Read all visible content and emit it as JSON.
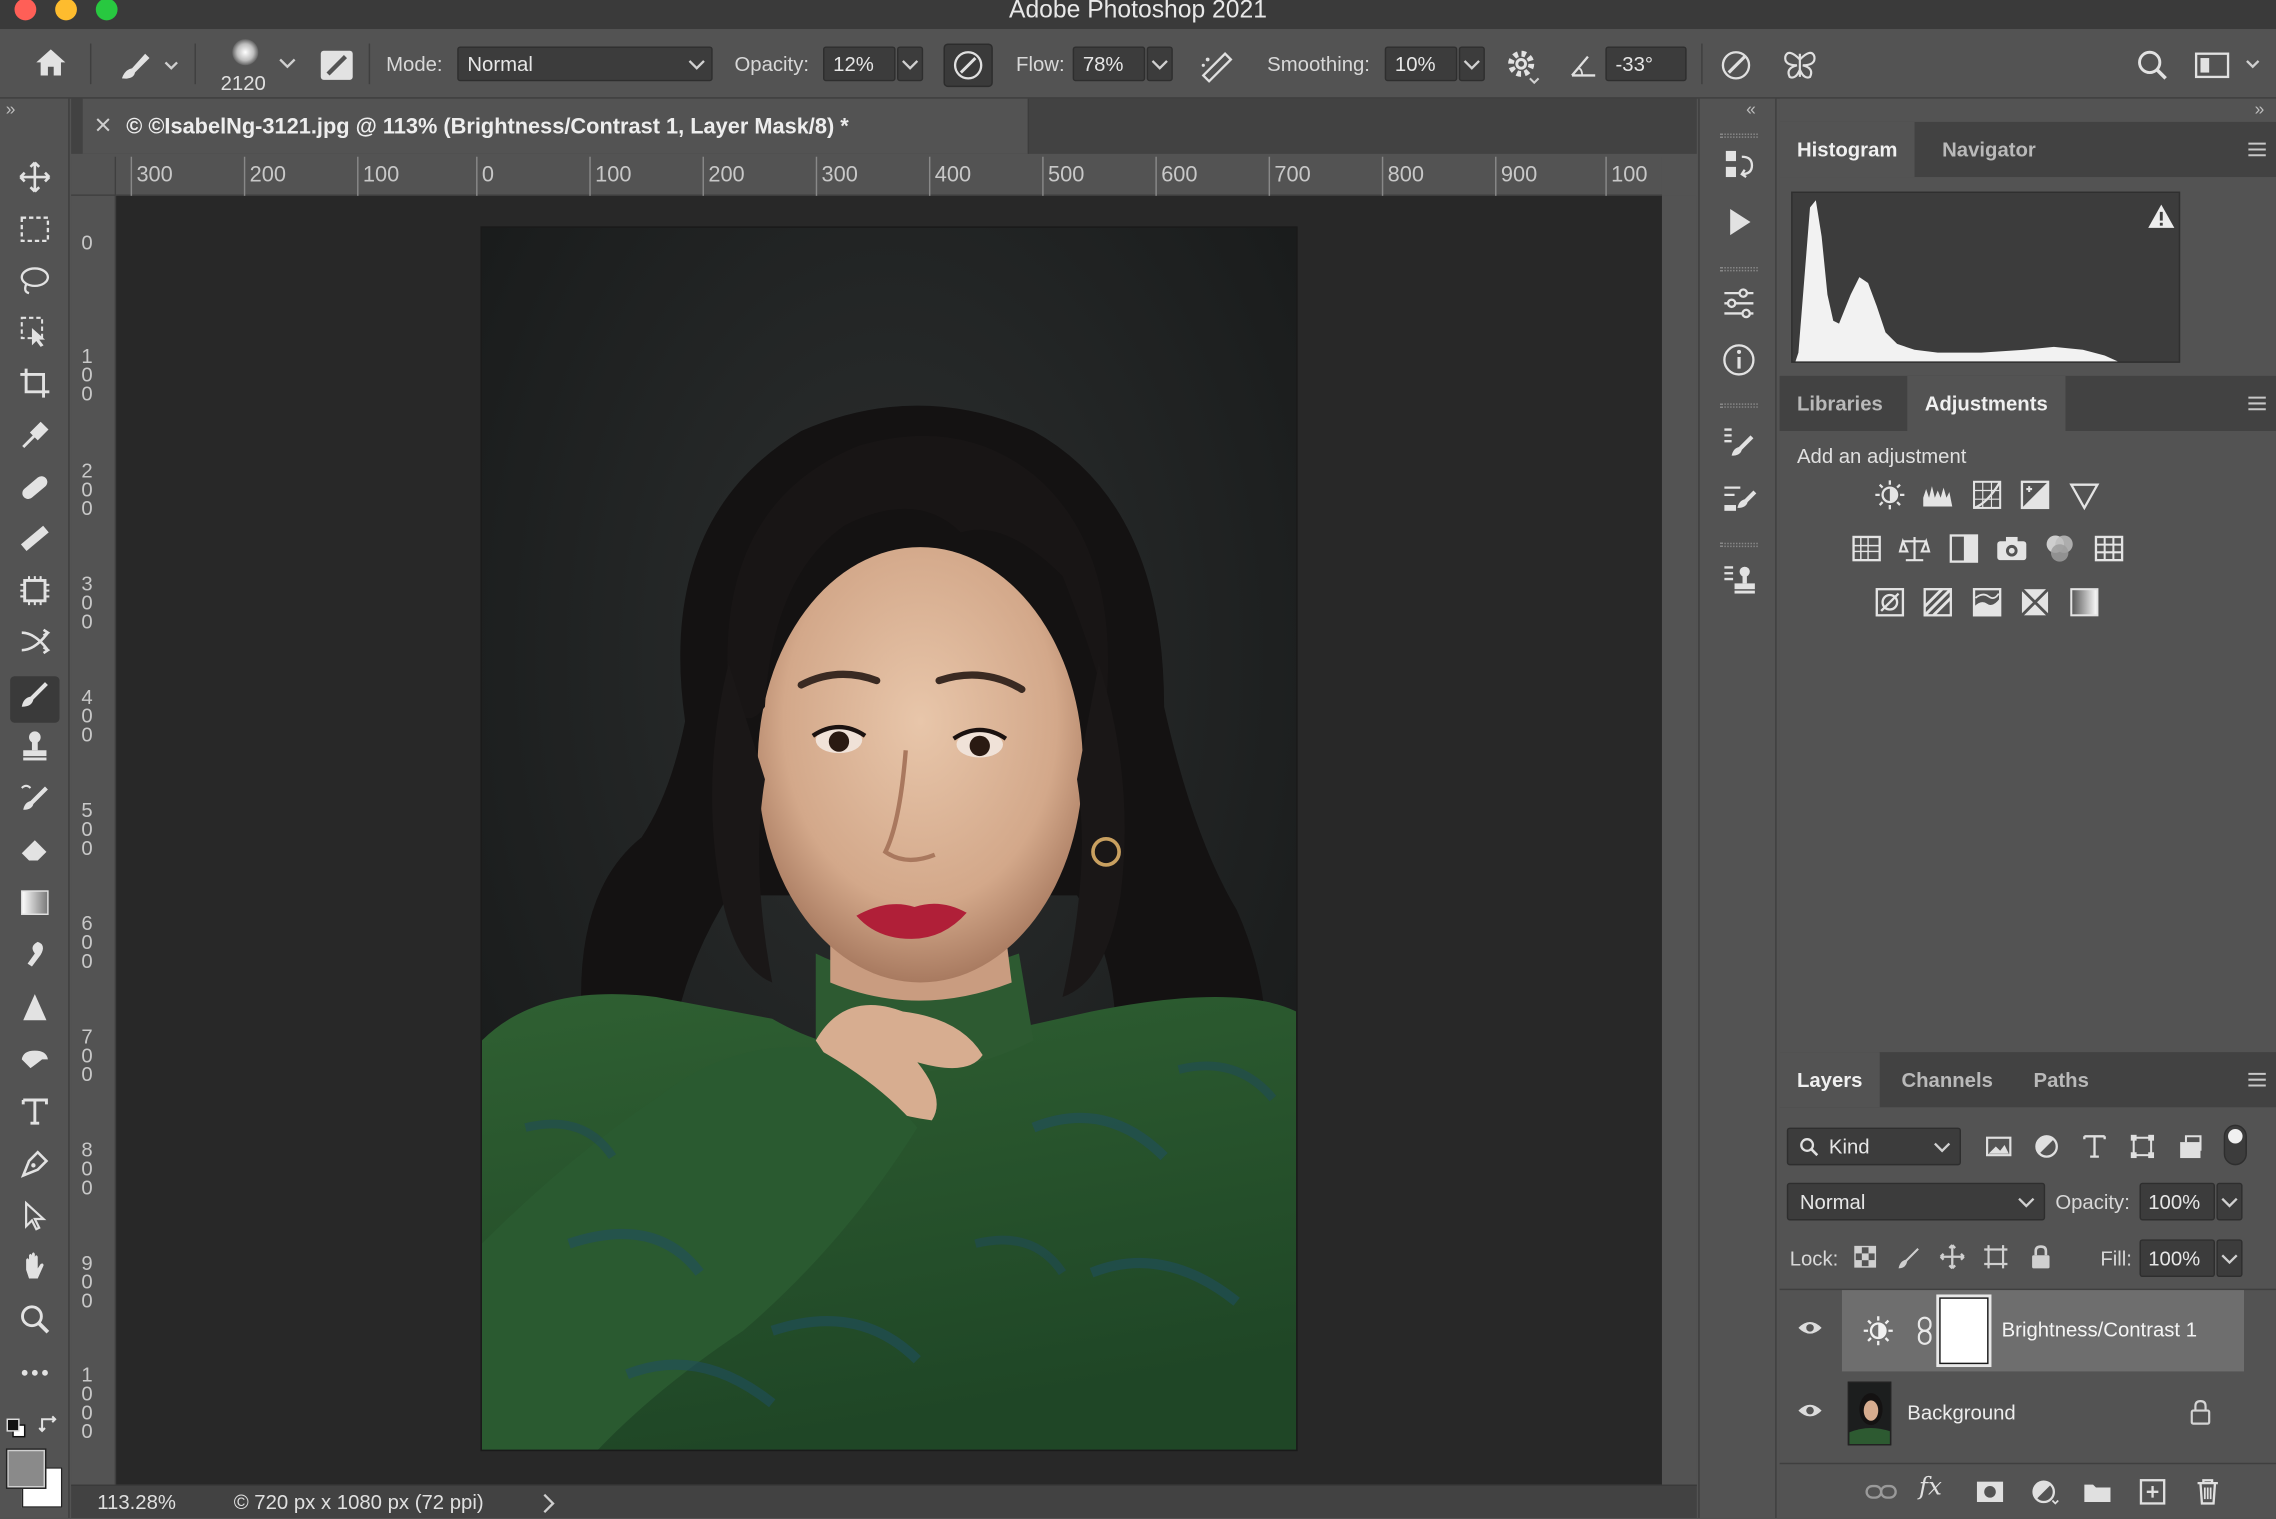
{
  "window": {
    "title": "Adobe Photoshop 2021"
  },
  "options_bar": {
    "brush_size": "2120",
    "mode_label": "Mode:",
    "mode_value": "Normal",
    "opacity_label": "Opacity:",
    "opacity_value": "12%",
    "flow_label": "Flow:",
    "flow_value": "78%",
    "smoothing_label": "Smoothing:",
    "smoothing_value": "10%",
    "angle_value": "-33°"
  },
  "document": {
    "tab_title": "© ©IsabelNg-3121.jpg @ 113% (Brightness/Contrast 1, Layer Mask/8) *",
    "ruler_top": [
      "300",
      "200",
      "100",
      "0",
      "100",
      "200",
      "300",
      "400",
      "500",
      "600",
      "700",
      "800",
      "900",
      "100"
    ],
    "ruler_left": [
      [
        "0"
      ],
      [
        "1",
        "0",
        "0"
      ],
      [
        "2",
        "0",
        "0"
      ],
      [
        "3",
        "0",
        "0"
      ],
      [
        "4",
        "0",
        "0"
      ],
      [
        "5",
        "0",
        "0"
      ],
      [
        "6",
        "0",
        "0"
      ],
      [
        "7",
        "0",
        "0"
      ],
      [
        "8",
        "0",
        "0"
      ],
      [
        "9",
        "0",
        "0"
      ],
      [
        "1",
        "0",
        "0",
        "0"
      ]
    ]
  },
  "status_bar": {
    "zoom": "113.28%",
    "doc_info": "© 720 px x 1080 px (72 ppi)"
  },
  "panels": {
    "top_tabs": [
      "Histogram",
      "Navigator"
    ],
    "mid_tabs": [
      "Libraries",
      "Adjustments"
    ],
    "adjustments_heading": "Add an adjustment",
    "layer_tabs": [
      "Layers",
      "Channels",
      "Paths"
    ]
  },
  "layers": {
    "filter_kind": "Kind",
    "blend_mode": "Normal",
    "opacity_label": "Opacity:",
    "opacity_value": "100%",
    "lock_label": "Lock:",
    "fill_label": "Fill:",
    "fill_value": "100%",
    "items": [
      {
        "name": "Brightness/Contrast 1",
        "selected": true
      },
      {
        "name": "Background",
        "selected": false
      }
    ]
  },
  "colors": {
    "ui_bg": "#535353",
    "ui_dark": "#424242",
    "canvas_bg": "#282828",
    "sweater_green": "#2e5a2f",
    "lip_red": "#b01f38"
  }
}
